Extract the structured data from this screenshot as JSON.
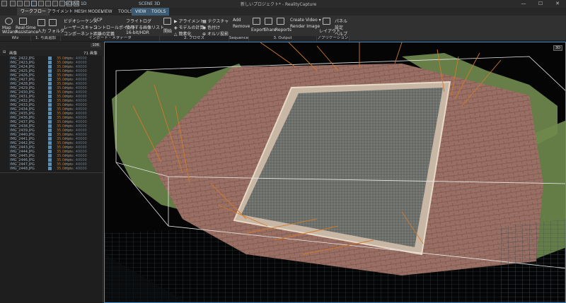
{
  "window": {
    "title": "新しいプロジェクト* - RealityCapture",
    "controls": [
      "—",
      "☐",
      "✕"
    ]
  },
  "tabs": [
    {
      "label": "ワークフロー",
      "active": true
    },
    {
      "label": "アライメント"
    },
    {
      "label": "MESH MODEL"
    },
    {
      "label": "VIEW"
    },
    {
      "label": "TOOLS"
    },
    {
      "label": "VIEW",
      "teal": true
    },
    {
      "label": "TOOLS",
      "teal": true
    }
  ],
  "scenes": [
    "SCENE 1D",
    "SCENE 3D"
  ],
  "ribbon": {
    "wizard": {
      "map": "Map\nWizard",
      "realtime": "Real-time\nAssistance"
    },
    "inputs": {
      "input": "入力",
      "folder": "フォルダ"
    },
    "imports": [
      "ビデオシーケンス",
      "レーザースキャン",
      "コンポーネント"
    ],
    "gcp": [
      "GCP",
      "コントロールポイント",
      "距離の定義"
    ],
    "flight": [
      "フライトログ",
      "使用する画像リスト",
      "16-bit/HDR"
    ],
    "process": {
      "align": "整列",
      "start": "開始"
    },
    "process_items": [
      "アライメント",
      "モデルの計算",
      "簡素化"
    ],
    "texture_items": [
      "テクスチャ",
      "色付け",
      "オルソ投影"
    ],
    "sequence_items": [
      "Add",
      "Remove"
    ],
    "output_items": [
      "Export",
      "Share",
      "Reports"
    ],
    "video_items": [
      "Create Video",
      "Render Image"
    ],
    "layout": "レイアウト",
    "app_items": [
      "パネル",
      "設定",
      "ヘルプ"
    ],
    "groups": [
      "Wiz",
      "1. 写真追加",
      "インポート・メタデータ",
      "2. プロセス",
      "Sequence",
      "3. Output",
      "アプリケーション"
    ]
  },
  "panel": {
    "count_badge": "106",
    "tree_root": "画像",
    "tree_count": "71 画像",
    "images": [
      {
        "name": "IMG_2422.JPG"
      },
      {
        "name": "IMG_2423.JPG"
      },
      {
        "name": "IMG_2424.JPG"
      },
      {
        "name": "IMG_2425.JPG"
      },
      {
        "name": "IMG_2426.JPG"
      },
      {
        "name": "IMG_2427.JPG"
      },
      {
        "name": "IMG_2428.JPG"
      },
      {
        "name": "IMG_2429.JPG"
      },
      {
        "name": "IMG_2430.JPG"
      },
      {
        "name": "IMG_2431.JPG"
      },
      {
        "name": "IMG_2432.JPG"
      },
      {
        "name": "IMG_2433.JPG"
      },
      {
        "name": "IMG_2434.JPG"
      },
      {
        "name": "IMG_2435.JPG"
      },
      {
        "name": "IMG_2436.JPG"
      },
      {
        "name": "IMG_2437.JPG"
      },
      {
        "name": "IMG_2438.JPG"
      },
      {
        "name": "IMG_2439.JPG"
      },
      {
        "name": "IMG_2440.JPG"
      },
      {
        "name": "IMG_2441.JPG"
      },
      {
        "name": "IMG_2442.JPG"
      },
      {
        "name": "IMG_2443.JPG"
      },
      {
        "name": "IMG_2444.JPG"
      },
      {
        "name": "IMG_2445.JPG"
      },
      {
        "name": "IMG_2446.JPG"
      },
      {
        "name": "IMG_2447.JPG"
      },
      {
        "name": "IMG_2448.JPG"
      }
    ],
    "lens_label": "35.0mm",
    "flag_label": "Hpts: 40000"
  },
  "viewport": {
    "badge": "3D",
    "colors": {
      "bg": "#050505",
      "grid": "#3a4a55",
      "brick": "#9a6f63",
      "grass": "#6f8a4d",
      "ray": "#d07a2a"
    }
  }
}
